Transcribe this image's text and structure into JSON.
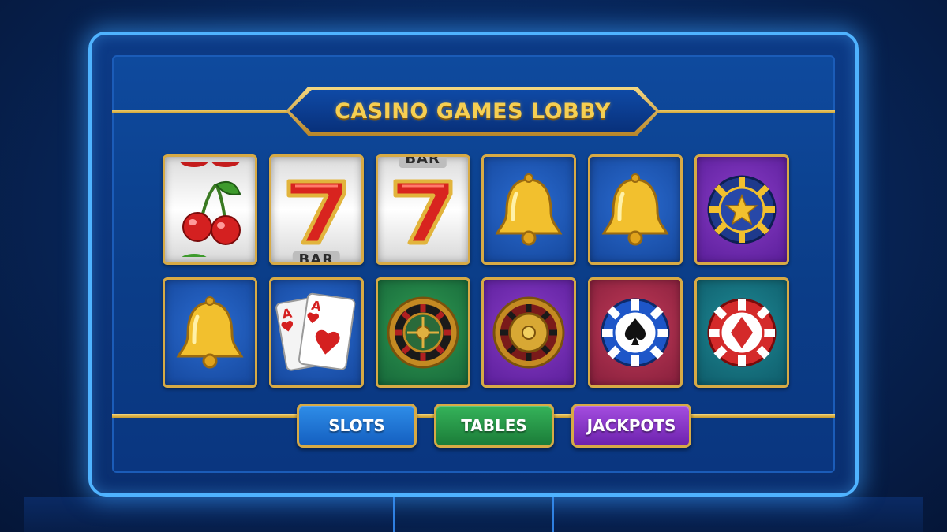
{
  "lobby": {
    "title": "CASINO GAMES LOBBY"
  },
  "tiles": [
    {
      "icon": "cherry-icon",
      "theme": "reel"
    },
    {
      "icon": "seven-icon",
      "theme": "reel",
      "reel_label": "BAR"
    },
    {
      "icon": "seven-icon",
      "theme": "reel",
      "reel_label": "BAR"
    },
    {
      "icon": "bell-icon",
      "theme": "blue"
    },
    {
      "icon": "bell-icon",
      "theme": "blue"
    },
    {
      "icon": "star-chip-icon",
      "theme": "purple"
    },
    {
      "icon": "bell-icon",
      "theme": "blue"
    },
    {
      "icon": "aces-cards-icon",
      "theme": "blue"
    },
    {
      "icon": "roulette-wheel-icon",
      "theme": "green"
    },
    {
      "icon": "roulette-wheel-icon",
      "theme": "purple"
    },
    {
      "icon": "spade-chip-icon",
      "theme": "red"
    },
    {
      "icon": "diamond-chip-icon",
      "theme": "teal"
    }
  ],
  "tabs": [
    {
      "label": "SLOTS",
      "color": "#1f74d4"
    },
    {
      "label": "TABLES",
      "color": "#26954a"
    },
    {
      "label": "JACKPOTS",
      "color": "#8a36c8"
    }
  ],
  "colors": {
    "gold": "#d7aa45",
    "title_gold": "#f6cf52",
    "frame_glow": "#4fb3ff"
  }
}
